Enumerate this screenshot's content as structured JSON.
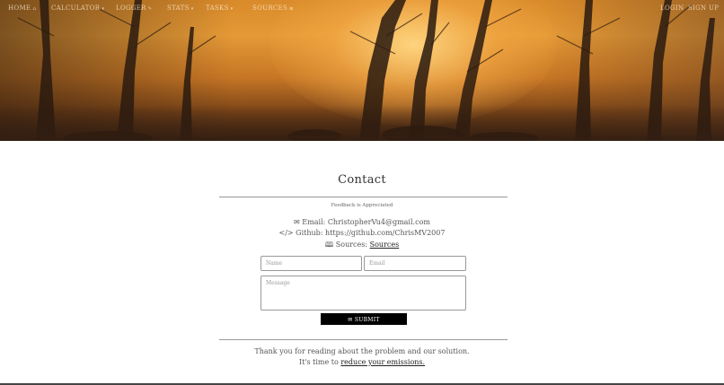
{
  "nav": {
    "items": [
      {
        "label": "HOME",
        "caret": "⌂"
      },
      {
        "label": "CALCULATOR",
        "caret": "▾"
      },
      {
        "label": "LOGGER",
        "caret": "✎"
      },
      {
        "label": "STATS",
        "caret": "▾"
      },
      {
        "label": "TASKS",
        "caret": "▾"
      },
      {
        "label": "SOURCES",
        "caret": "⊞"
      }
    ],
    "right_items": [
      {
        "label": "LOGIN"
      },
      {
        "label": "SIGN UP"
      }
    ]
  },
  "contact": {
    "title": "Contact",
    "subtitle": "Feedback is Appreciated",
    "email_prefix": "✉ Email: ",
    "email_value": "ChristopherVu4@gmail.com",
    "github_prefix": "</> Github: ",
    "github_value": "https://github.com/ChrisMV2007",
    "sources_prefix": "🕮 Sources: ",
    "sources_link": "Sources"
  },
  "form": {
    "name_placeholder": "Name",
    "email_placeholder": "Email",
    "message_placeholder": "Message",
    "submit_label": "✉ SUBMIT"
  },
  "footer": {
    "thanks_line": "Thank you for reading about the problem and our solution.",
    "time_prefix": "It's time to ",
    "time_link": "reduce your emissions."
  },
  "colors": {
    "submit_bg": "#000000",
    "hero_tone": "#d98a2a"
  }
}
